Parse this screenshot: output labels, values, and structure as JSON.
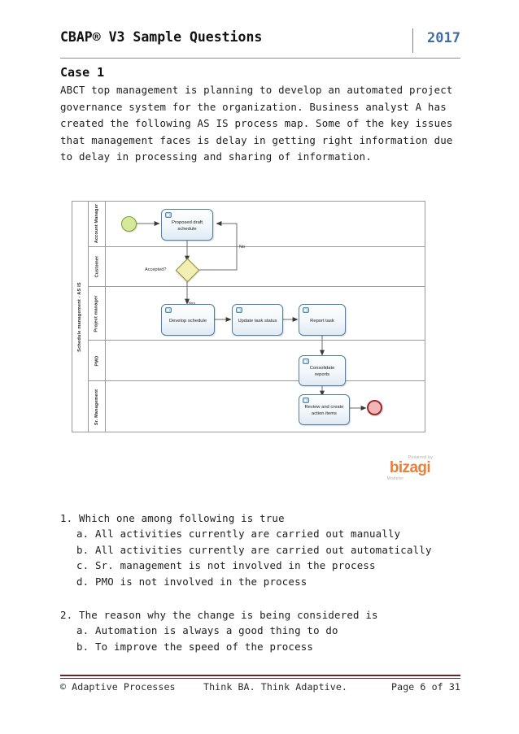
{
  "header": {
    "title": "CBAP® V3 Sample Questions",
    "year": "2017"
  },
  "case": {
    "heading": "Case 1",
    "paragraph_lines": [
      "ABCT top management is planning to develop an automated project",
      "governance system for the organization. Business analyst A has",
      "created the following AS IS process map. Some of the key issues",
      "that management faces is delay in getting right information due",
      "to delay in processing and sharing of information."
    ]
  },
  "diagram": {
    "pool_label": "Schedule management - AS IS",
    "lanes": [
      {
        "label": "Account Manager"
      },
      {
        "label": "Customer"
      },
      {
        "label": "Project manager"
      },
      {
        "label": "PMO"
      },
      {
        "label": "Sr. Management"
      }
    ],
    "nodes": {
      "start_event": "start-event",
      "task_proposed_draft_schedule": "Proposed draft schedule",
      "gateway_accepted": "Accepted?",
      "task_develop_schedule": "Develop schedule",
      "task_update_task_status": "Update task status",
      "task_report_task": "Report task",
      "task_consolidate_reports": "Consolidate reports",
      "task_review_action_items": "Review and create action items",
      "end_event": "end-event"
    },
    "flow_labels": {
      "no": "No",
      "yes": "Yes"
    },
    "colors": {
      "start_fill": "#d4ea9a",
      "start_stroke": "#7f9c38",
      "end_fill": "#f2b6b6",
      "end_stroke": "#9c2b2b",
      "gateway_fill": "#f2efb4",
      "gateway_stroke": "#93892f",
      "task_stroke": "#4f81a8",
      "lane_stroke": "#9a9a9a"
    }
  },
  "watermark": {
    "powered_by": "Powered by",
    "brand": "bizagi",
    "product": "Modeler",
    "brand_color": "#e8803a"
  },
  "questions": [
    {
      "stem": "1. Which one among following is true",
      "options": [
        "a. All activities currently are carried out manually",
        "b. All activities currently are carried out automatically",
        "c. Sr. management is not involved in the process",
        "d. PMO is not involved in the process"
      ]
    },
    {
      "stem": "2. The reason why the change is being considered is",
      "options": [
        "a. Automation is always a good thing to do",
        "b. To improve the speed of the process"
      ]
    }
  ],
  "footer": {
    "left": "© Adaptive Processes",
    "center": "Think BA. Think Adaptive.",
    "right": "Page 6 of 31",
    "rule_color": "#5d2b25"
  }
}
